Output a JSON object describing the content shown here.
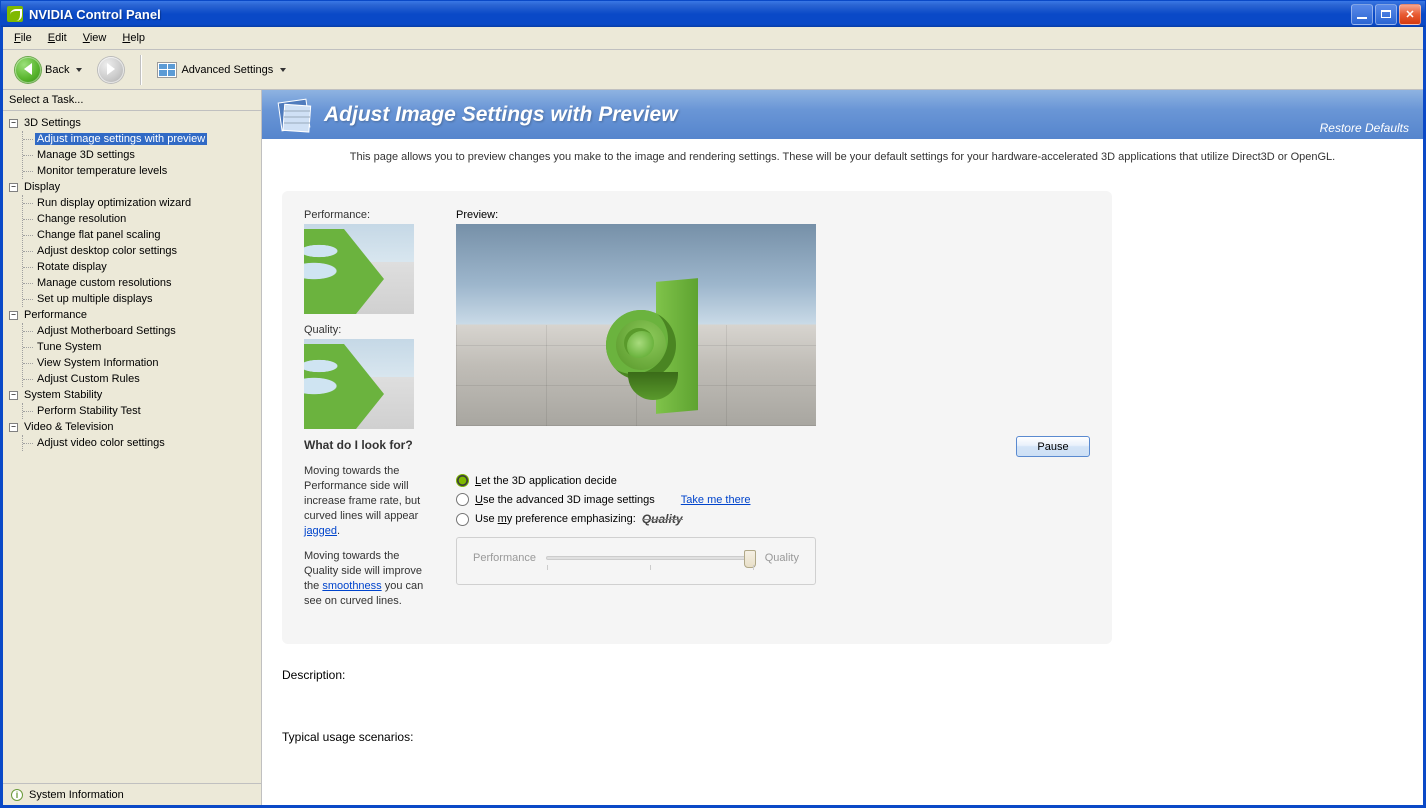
{
  "window": {
    "title": "NVIDIA Control Panel"
  },
  "menu": {
    "file": "File",
    "edit": "Edit",
    "view": "View",
    "help": "Help"
  },
  "toolbar": {
    "back": "Back",
    "advanced": "Advanced Settings"
  },
  "sidebar": {
    "select_task": "Select a Task...",
    "sections": [
      {
        "label": "3D Settings",
        "items": [
          "Adjust image settings with preview",
          "Manage 3D settings",
          "Monitor temperature levels"
        ],
        "selected": 0
      },
      {
        "label": "Display",
        "items": [
          "Run display optimization wizard",
          "Change resolution",
          "Change flat panel scaling",
          "Adjust desktop color settings",
          "Rotate display",
          "Manage custom resolutions",
          "Set up multiple displays"
        ]
      },
      {
        "label": "Performance",
        "items": [
          "Adjust Motherboard Settings",
          "Tune System",
          "View System Information",
          "Adjust Custom Rules"
        ]
      },
      {
        "label": "System Stability",
        "items": [
          "Perform Stability Test"
        ]
      },
      {
        "label": "Video & Television",
        "items": [
          "Adjust video color settings"
        ]
      }
    ],
    "sysinfo": "System Information"
  },
  "page": {
    "title": "Adjust Image Settings with Preview",
    "restore": "Restore Defaults",
    "desc": "This page allows you to preview changes you make to the image and rendering settings. These will be your default settings for your hardware-accelerated 3D applications that utilize Direct3D or OpenGL.",
    "perf_label": "Performance:",
    "qual_label": "Quality:",
    "preview_label": "Preview:",
    "what_head": "What do I look for?",
    "what_p1a": "Moving towards the Performance side will increase frame rate, but curved lines will appear ",
    "what_link1": "jagged",
    "what_p1b": ".",
    "what_p2a": "Moving towards the Quality side will improve the ",
    "what_link2": "smoothness",
    "what_p2b": " you can see on curved lines.",
    "pause": "Pause",
    "radio1": "Let the 3D application decide",
    "radio2": "Use the advanced 3D image settings",
    "radio3": "Use my preference emphasizing:",
    "emph_word": "Quality",
    "takeme": "Take me there",
    "slider_left": "Performance",
    "slider_right": "Quality",
    "desc_label": "Description:",
    "usage_label": "Typical usage scenarios:",
    "radio_underline": {
      "r1": "L",
      "r2": "U",
      "r3": "m"
    }
  }
}
